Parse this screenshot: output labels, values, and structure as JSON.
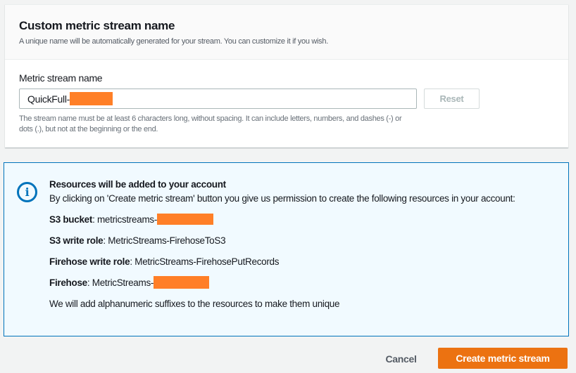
{
  "section": {
    "title": "Custom metric stream name",
    "subtitle": "A unique name will be automatically generated for your stream. You can customize it if you wish.",
    "field_label": "Metric stream name",
    "field_value": "QuickFull-",
    "reset": "Reset",
    "help": "The stream name must be at least 6 characters long, without spacing. It can include letters, numbers, and dashes (-) or dots (.), but not at the beginning or the end."
  },
  "info": {
    "title": "Resources will be added to your account",
    "intro": "By clicking on 'Create metric stream' button you give us permission to create the following resources in your account:",
    "resources": [
      {
        "label": "S3 bucket",
        "value": "metricstreams-"
      },
      {
        "label": "S3 write role",
        "value": "MetricStreams-FirehoseToS3"
      },
      {
        "label": "Firehose write role",
        "value": "MetricStreams-FirehosePutRecords"
      },
      {
        "label": "Firehose",
        "value": "MetricStreams-"
      }
    ],
    "footer": "We will add alphanumeric suffixes to the resources to make them unique"
  },
  "actions": {
    "cancel": "Cancel",
    "create": "Create metric stream"
  },
  "colors": {
    "accent": "#ec7211",
    "info_border": "#0073bb",
    "redaction": "#ff7f27"
  }
}
